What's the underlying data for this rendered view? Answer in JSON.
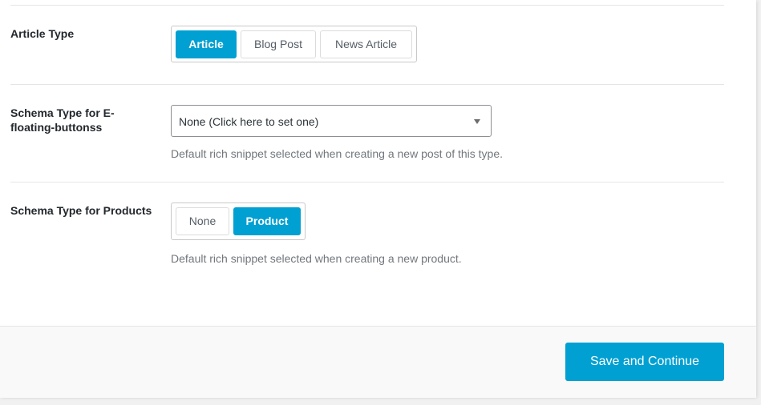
{
  "article_type": {
    "label": "Article Type",
    "options": [
      {
        "label": "Article",
        "active": true
      },
      {
        "label": "Blog Post",
        "active": false
      },
      {
        "label": "News Article",
        "active": false
      }
    ]
  },
  "schema_floating": {
    "label": "Schema Type for E-floating-buttonss",
    "select_value": "None (Click here to set one)",
    "help": "Default rich snippet selected when creating a new post of this type."
  },
  "schema_products": {
    "label": "Schema Type for Products",
    "options": [
      {
        "label": "None",
        "active": false
      },
      {
        "label": "Product",
        "active": true
      }
    ],
    "help": "Default rich snippet selected when creating a new product."
  },
  "footer": {
    "save_label": "Save and Continue"
  },
  "colors": {
    "accent": "#00a0d2",
    "text": "#23282d",
    "muted": "#72777c"
  }
}
